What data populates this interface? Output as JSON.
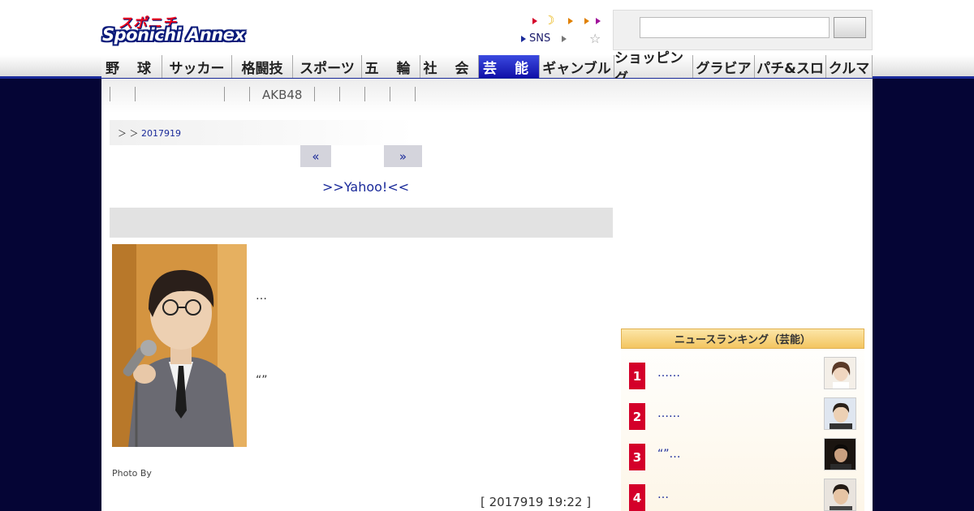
{
  "header": {
    "logo_kana": "スポニチ",
    "logo_word": "Sponichi Annex",
    "util_sns": "SNS",
    "search_placeholder": ""
  },
  "nav": {
    "items": [
      {
        "label": "野 球"
      },
      {
        "label": "サッカー"
      },
      {
        "label": "格闘技"
      },
      {
        "label": "スポーツ"
      },
      {
        "label": "五 輪"
      },
      {
        "label": "社 会"
      },
      {
        "label": "芸 能"
      },
      {
        "label": "ギャンブル"
      },
      {
        "label": "ショッピング"
      },
      {
        "label": "グラビア"
      },
      {
        "label": "パチ&スロ"
      },
      {
        "label": "クルマ"
      }
    ],
    "active_index": 6
  },
  "subnav": {
    "akb_label": "AKB48"
  },
  "breadcrumb": {
    "prefix": "＞ ＞ ",
    "date": "2017919"
  },
  "pager": {
    "prev": "«",
    "next": "»"
  },
  "article": {
    "yahoo_link": ">>Yahoo!<<",
    "text1": "…",
    "text2": "“”",
    "caption": "Photo By",
    "timestamp": "[ 2017919 19:22 ]"
  },
  "ranking": {
    "title": "ニュースランキング（芸能）",
    "items": [
      {
        "rank": "1",
        "text": "……"
      },
      {
        "rank": "2",
        "text": "……"
      },
      {
        "rank": "3",
        "text": "“”…"
      },
      {
        "rank": "4",
        "text": "…"
      }
    ]
  },
  "colors": {
    "nav_active": "#1a2a9a",
    "accent_red": "#d4002a",
    "page_bg": "#050535",
    "link": "#1a2a9a"
  }
}
